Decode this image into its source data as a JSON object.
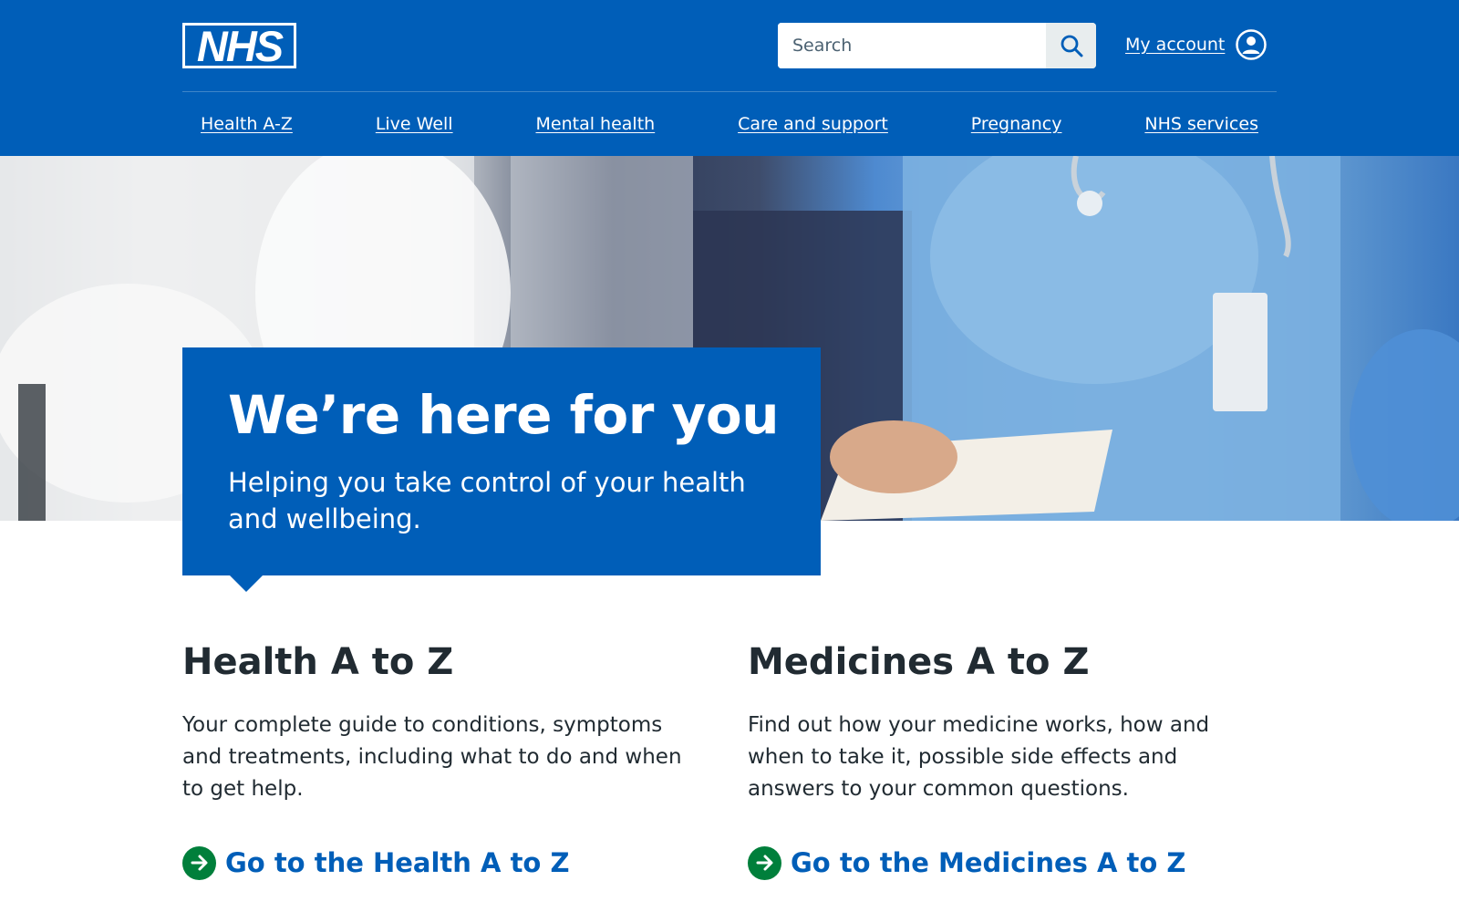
{
  "header": {
    "logo": "NHS",
    "search": {
      "placeholder": "Search",
      "value": ""
    },
    "account_label": "My account",
    "icons": {
      "search": "search-icon",
      "account": "user-circle-icon"
    }
  },
  "nav": {
    "items": [
      {
        "label": "Health A-Z"
      },
      {
        "label": "Live Well"
      },
      {
        "label": "Mental health"
      },
      {
        "label": "Care and support"
      },
      {
        "label": "Pregnancy"
      },
      {
        "label": "NHS services"
      }
    ]
  },
  "hero": {
    "title": "We’re here for you",
    "subtitle": "Helping you take control of your health and wellbeing."
  },
  "sections": [
    {
      "heading": "Health A to Z",
      "body": "Your complete guide to conditions, symptoms and treatments, including what to do and when to get help.",
      "link": "Go to the Health A to Z"
    },
    {
      "heading": "Medicines A to Z",
      "body": "Find out how your medicine works, how and when to take it, possible side effects and answers to your common questions.",
      "link": "Go to the Medicines A to Z"
    }
  ],
  "colors": {
    "nhs_blue": "#005eb8",
    "text": "#212b32",
    "arrow_green": "#007f3b",
    "search_button_bg": "#e8edee"
  }
}
